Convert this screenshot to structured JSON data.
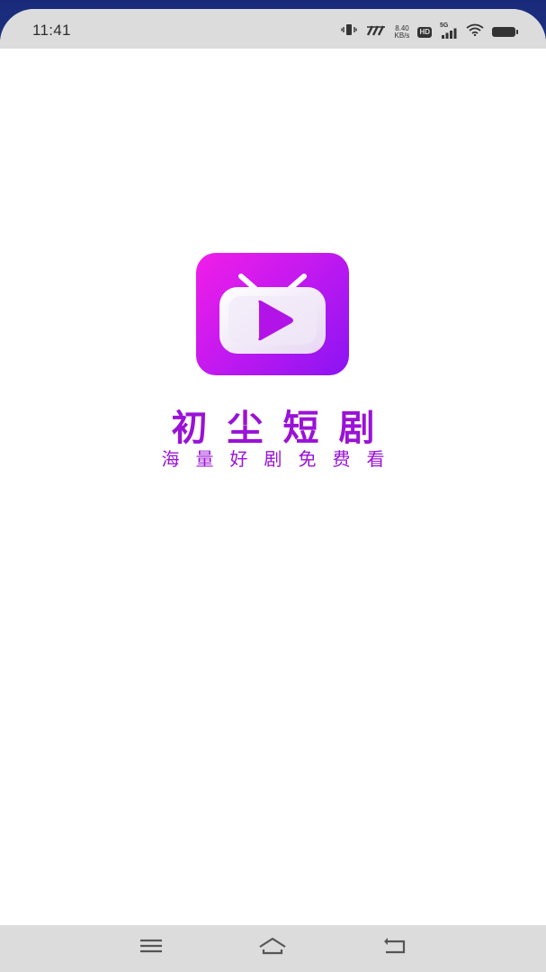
{
  "status_bar": {
    "time": "11:41",
    "speed_value": "8.40",
    "speed_unit": "KB/s",
    "hd_label": "HD",
    "network_label": "5G",
    "icons": [
      "vibrate-icon",
      "no-disturb-icon",
      "hd-icon",
      "signal-icon",
      "wifi-icon",
      "battery-icon"
    ]
  },
  "splash": {
    "app_name": "初尘短剧",
    "slogan": "海量好剧免费看",
    "logo_icon": "tv-play-icon",
    "brand_colors": {
      "gradient_start": "#f21ee8",
      "gradient_end": "#8a14f2",
      "text": "#9a12d6"
    }
  },
  "nav_bar": {
    "items": [
      {
        "name": "menu",
        "icon": "menu-icon"
      },
      {
        "name": "home",
        "icon": "home-icon"
      },
      {
        "name": "back",
        "icon": "back-icon"
      }
    ]
  }
}
